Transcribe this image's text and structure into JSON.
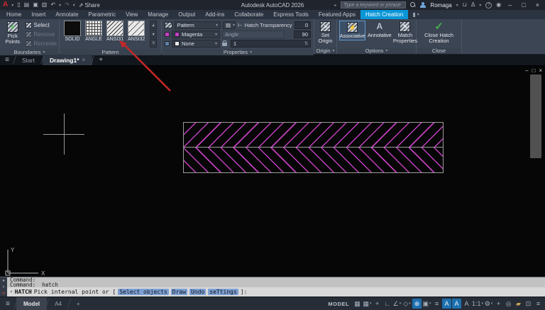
{
  "title_bar": {
    "app_title": "Autodesk AutoCAD 2026",
    "share_label": "Share",
    "search_placeholder": "Type a keyword or phrase",
    "user_name": "Romaga"
  },
  "ribbon_tabs": {
    "tabs": [
      "Home",
      "Insert",
      "Annotate",
      "Parametric",
      "View",
      "Manage",
      "Output",
      "Add-ins",
      "Collaborate",
      "Express Tools",
      "Featured Apps",
      "Hatch Creation"
    ],
    "active_tab": "Hatch Creation"
  },
  "ribbon": {
    "boundaries": {
      "label": "Boundaries",
      "pick_points": "Pick Points",
      "select": "Select",
      "remove": "Remove",
      "recreate": "Recreate"
    },
    "pattern": {
      "label": "Pattern",
      "swatches": [
        "SOLID",
        "ANGLE",
        "ANSI31",
        "ANSI32"
      ]
    },
    "properties": {
      "label": "Properties",
      "type_value": "Pattern",
      "color_value": "Magenta",
      "background_value": "None",
      "transparency_label": "Hatch Transparency",
      "transparency_value": "0",
      "angle_label": "Angle",
      "angle_value": "90",
      "scale_value": "1"
    },
    "origin": {
      "label": "Origin",
      "set_origin": "Set Origin"
    },
    "options": {
      "label": "Options",
      "associative": "Associative",
      "annotative": "Annotative",
      "match_properties": "Match Properties"
    },
    "close": {
      "label": "Close",
      "button": "Close Hatch Creation"
    }
  },
  "file_tabs": {
    "start": "Start",
    "drawing": "Drawing1*"
  },
  "canvas": {
    "ucs_x": "X",
    "ucs_y": "Y"
  },
  "command_line": {
    "history": [
      "Command:",
      "Command: _hatch"
    ],
    "prompt_command": "HATCH",
    "prompt_pre": "Pick internal point or [",
    "options": [
      "Select objects",
      "Draw",
      "Undo",
      "seTtings"
    ],
    "prompt_post": "]:"
  },
  "status_bar": {
    "model_tab": "Model",
    "a4_tab": "A4",
    "model_label": "MODEL",
    "scale": "1:1",
    "icons": [
      "▦",
      "▦",
      "+",
      "∟",
      "∠",
      "◇",
      "⊕",
      "▣",
      "≡",
      "A",
      "A",
      "A",
      "⚙",
      "+",
      "◎",
      "▰",
      "⊡",
      "≡"
    ]
  },
  "icons": {
    "logo": "A",
    "dropdown": "▾",
    "up": "▴",
    "hamburger": "≡",
    "plus": "+",
    "close": "×",
    "minimize": "–",
    "restore": "□",
    "undo": "↶",
    "redo": "↷",
    "share": "⇗",
    "new_file": "▯",
    "open": "▤",
    "save": "▣",
    "plot": "▥",
    "check": "✓",
    "alert": "Δ",
    "help": "?",
    "account": "◉",
    "cart": "⊔",
    "expand": "▸",
    "spinner": "⇅",
    "lightning": "⚡",
    "pencil": "✎",
    "corner_arrow": "↘",
    "gallery_more": "≡"
  },
  "colors": {
    "accent": "#0a96d7",
    "hatch_magenta": "#c33fc0",
    "arrow_red": "#c62828",
    "check_green": "#46b050",
    "pick_plus_green": "#57c25b",
    "osnap_highlight": "#1d6fae"
  }
}
